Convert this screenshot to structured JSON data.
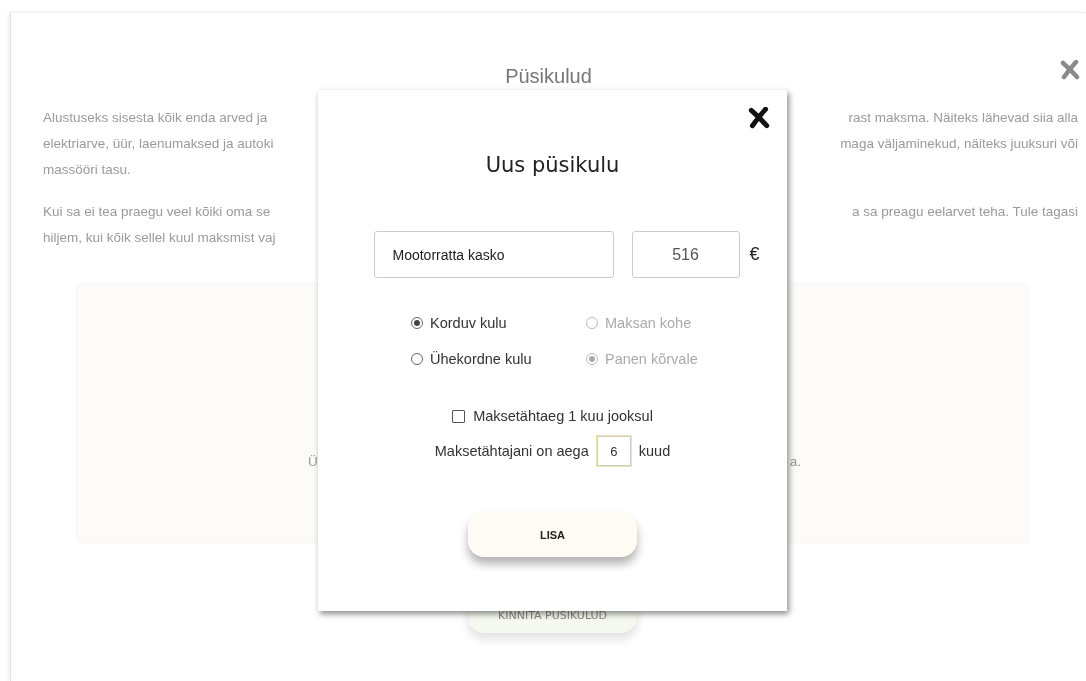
{
  "page": {
    "title": "Püsikulud",
    "paragraphs": [
      {
        "left_lines": [
          "Alustuseks sisesta kõik enda arved ja",
          "elektriarve, üür, laenumaksed ja autoki",
          "massööri tasu."
        ],
        "right_lines": [
          "rast maksma. Näiteks lähevad siia alla",
          "maga väljaminekud, näiteks juuksuri või"
        ]
      },
      {
        "left_lines": [
          "Kui sa ei tea praegu veel kõiki oma se",
          "hiljem, kui kõik sellel kuul maksmist vaj"
        ],
        "right_lines": [
          "a sa preagu eelarvet teha. Tule tagasi"
        ]
      }
    ],
    "card": {
      "left_text": "Ü",
      "right_text": "a."
    },
    "confirm_button": "KINNITA PÜSIKULUD"
  },
  "modal": {
    "title": "Uus püsikulu",
    "name_field": {
      "value": "Mootorratta kasko"
    },
    "amount_field": {
      "value": "516"
    },
    "currency": "€",
    "radio_groups": [
      [
        {
          "label": "Korduv kulu",
          "selected": true,
          "disabled": false
        },
        {
          "label": "Ühekordne kulu",
          "selected": false,
          "disabled": false
        }
      ],
      [
        {
          "label": "Maksan kohe",
          "selected": false,
          "disabled": true
        },
        {
          "label": "Panen kõrvale",
          "selected": true,
          "disabled": true
        }
      ]
    ],
    "checkbox": {
      "label": "Maksetähtaeg 1 kuu jooksul",
      "checked": false
    },
    "months": {
      "prefix": "Maksetähtajani on aega",
      "value": "6",
      "suffix": "kuud"
    },
    "submit_button": "LISA"
  }
}
